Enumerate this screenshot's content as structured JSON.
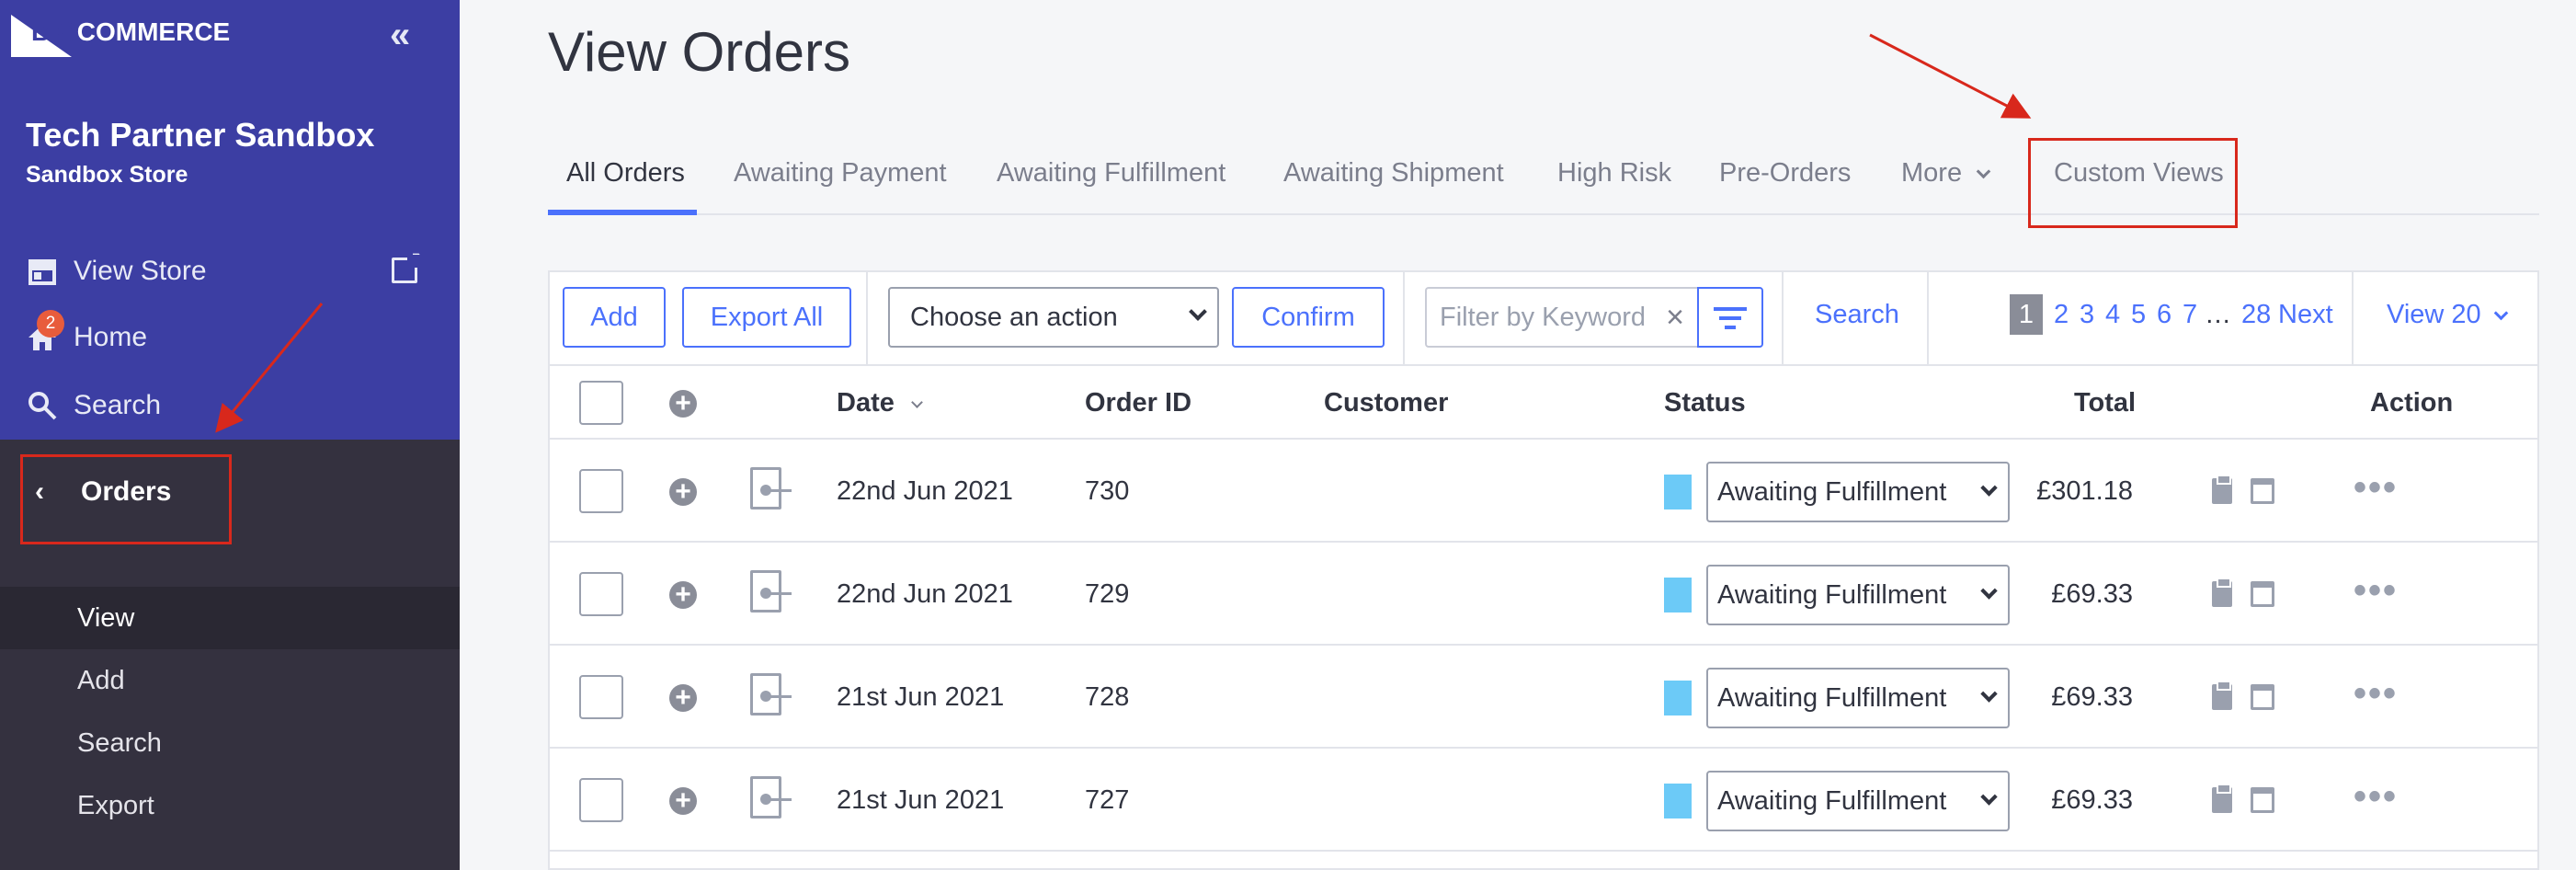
{
  "sidebar": {
    "logo": "BIGCOMMERCE",
    "logo_big": "BIG",
    "logo_rest": "COMMERCE",
    "collapse_glyph": "«",
    "store_name": "Tech Partner Sandbox",
    "store_subtitle": "Sandbox Store",
    "nav": [
      {
        "label": "View Store",
        "icon": "store-icon"
      },
      {
        "label": "Home",
        "icon": "home-icon",
        "badge": "2"
      },
      {
        "label": "Search",
        "icon": "search-icon"
      }
    ],
    "section": {
      "label": "Orders",
      "icon": "chevron-left-icon"
    },
    "sub_items": [
      {
        "label": "View",
        "active": true
      },
      {
        "label": "Add",
        "active": false
      },
      {
        "label": "Search",
        "active": false
      },
      {
        "label": "Export",
        "active": false
      }
    ]
  },
  "main": {
    "title": "View Orders",
    "tabs": [
      {
        "label": "All Orders",
        "active": true
      },
      {
        "label": "Awaiting Payment"
      },
      {
        "label": "Awaiting Fulfillment"
      },
      {
        "label": "Awaiting Shipment"
      },
      {
        "label": "High Risk"
      },
      {
        "label": "Pre-Orders"
      },
      {
        "label": "More"
      },
      {
        "label": "Custom Views"
      }
    ],
    "toolbar": {
      "add_label": "Add",
      "export_label": "Export All",
      "action_select_value": "Choose an action",
      "confirm_label": "Confirm",
      "filter_placeholder": "Filter by Keyword",
      "search_label": "Search",
      "pages": [
        "1",
        "2",
        "3",
        "4",
        "5",
        "6",
        "7"
      ],
      "ellipsis": "…",
      "last_page": "28",
      "next_label": "Next",
      "view_label": "View 20"
    },
    "table": {
      "columns": {
        "date": "Date",
        "order_id": "Order ID",
        "customer": "Customer",
        "status": "Status",
        "total": "Total",
        "action": "Action"
      },
      "rows": [
        {
          "date": "22nd Jun 2021",
          "order_id": "730",
          "status": "Awaiting Fulfillment",
          "total": "£301.18"
        },
        {
          "date": "22nd Jun 2021",
          "order_id": "729",
          "status": "Awaiting Fulfillment",
          "total": "£69.33"
        },
        {
          "date": "21st Jun 2021",
          "order_id": "728",
          "status": "Awaiting Fulfillment",
          "total": "£69.33"
        },
        {
          "date": "21st Jun 2021",
          "order_id": "727",
          "status": "Awaiting Fulfillment",
          "total": "£69.33"
        }
      ]
    }
  },
  "colors": {
    "sidebar_top": "#3c3ea3",
    "sidebar_bottom": "#34313f",
    "accent": "#4b71fc",
    "status_awaiting_fulfillment": "#6ccaf7",
    "annotation": "#d8281c"
  }
}
